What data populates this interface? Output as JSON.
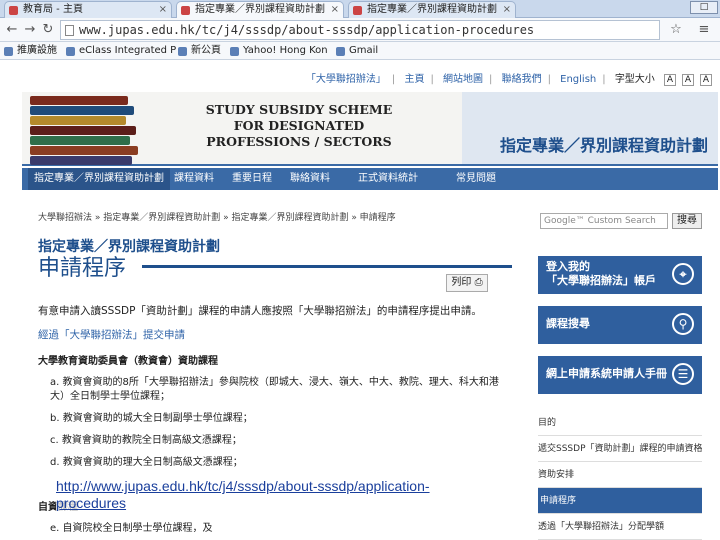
{
  "browser": {
    "tabs": [
      {
        "label": "教育局 - 主頁"
      },
      {
        "label": "指定專業／界別課程資助計劃"
      },
      {
        "label": "指定專業／界別課程資助計劃"
      }
    ],
    "window_control": "□",
    "url": "www.jupas.edu.hk/tc/j4/sssdp/about-sssdp/application-procedures",
    "bookmarks": [
      {
        "label": "推廣設施"
      },
      {
        "label": "eClass Integrated P"
      },
      {
        "label": "新公頁"
      },
      {
        "label": "Yahoo! Hong Kon"
      },
      {
        "label": "Gmail"
      }
    ]
  },
  "site": {
    "top_links": [
      "「大學聯招辦法」",
      "主頁",
      "網站地圖",
      "聯絡我們",
      "English",
      "字型大小"
    ],
    "font_sizes": [
      "A",
      "A",
      "A"
    ],
    "banner_en": "STUDY SUBSIDY SCHEME FOR DESIGNATED PROFESSIONS / SECTORS",
    "banner_zh": "指定專業／界別課程資助計劃",
    "nav": [
      "指定專業／界別課程資助計劃",
      "課程資料",
      "重要日程",
      "聯絡資料",
      "正式資料統計",
      "常見問題"
    ]
  },
  "content": {
    "breadcrumb": "大學聯招辦法 » 指定專業／界別課程資助計劃 » 指定專業／界別課程資助計劃 » 申請程序",
    "title": "指定專業／界別課程資助計劃",
    "heading": "申請程序",
    "print_label": "列印",
    "intro": "有意申請入讀SSSDP「資助計劃」課程的申請人應按照「大學聯招辦法」的申請程序提出申請。",
    "via_link": "經過「大學聯招辦法」提交申請",
    "section1": "大學教育資助委員會（教資會）資助課程",
    "list": [
      "a. 教資會資助的8所「大學聯招辦法」參與院校（即城大、浸大、嶺大、中大、教院、理大、科大和港大）全日制學士學位課程；",
      "b. 教資會資助的城大全日制副學士學位課程；",
      "c. 教資會資助的教院全日制高級文憑課程；",
      "d. 教資會資助的理大全日制高級文憑課程；"
    ],
    "section2": "自資課程",
    "list2_item": "e. 自資院校全日制學士學位課程，及"
  },
  "sidebar": {
    "search_placeholder": "Google™ Custom Search",
    "search_button": "搜尋",
    "boxes": [
      {
        "line1": "登入我的",
        "line2": "「大學聯招辦法」帳戶"
      },
      {
        "line1": "課程搜尋",
        "line2": ""
      },
      {
        "line1": "網上申請系統申請人手冊",
        "line2": ""
      }
    ],
    "links": [
      "目的",
      "遞交SSSDP「資助計劃」課程的申請資格",
      "資助安排",
      "申請程序",
      "透過「大學聯招辦法」分配學額"
    ]
  },
  "overlay": {
    "line1": "http://www.jupas.edu.hk/tc/j4/sssdp/about-sssdp/application-",
    "line2": "procedures"
  },
  "colors": {
    "brand": "#3a6aa6",
    "heading": "#1e4f8c",
    "overlay_link": "#1a3f9c"
  }
}
